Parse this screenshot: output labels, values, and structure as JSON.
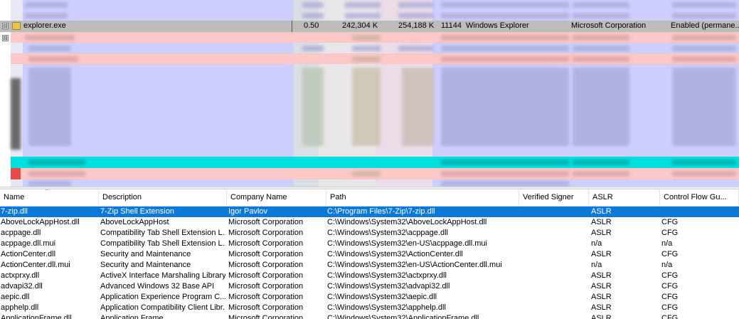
{
  "process_pane": {
    "explorer_row": {
      "name": "explorer.exe",
      "cpu": "0.50",
      "private_bytes": "242,304 K",
      "working_set": "254,188 K",
      "pid": "11144",
      "description": "Windows Explorer",
      "company": "Microsoft Corporation",
      "dep": "Enabled (permane...",
      "expander": "⊟"
    },
    "second_expander": "⊟",
    "colors": {
      "highlight_service": "#cfcfff",
      "new_process": "#ffc8c8",
      "cyan": "#00e0e0",
      "selected_gray": "#bcbcbc"
    }
  },
  "dll_pane": {
    "columns": [
      "Name",
      "Description",
      "Company Name",
      "Path",
      "Verified Signer",
      "ASLR",
      "Control Flow Gu..."
    ],
    "sort_indicator": "^",
    "rows": [
      {
        "name": "7-zip.dll",
        "desc": "7-Zip Shell Extension",
        "company": "Igor Pavlov",
        "path": "C:\\Program Files\\7-Zip\\7-zip.dll",
        "signer": "",
        "aslr": "ASLR",
        "cfg": ""
      },
      {
        "name": "AboveLockAppHost.dll",
        "desc": "AboveLockAppHost",
        "company": "Microsoft Corporation",
        "path": "C:\\Windows\\System32\\AboveLockAppHost.dll",
        "signer": "",
        "aslr": "ASLR",
        "cfg": "CFG"
      },
      {
        "name": "acppage.dll",
        "desc": "Compatibility Tab Shell Extension L...",
        "company": "Microsoft Corporation",
        "path": "C:\\Windows\\System32\\acppage.dll",
        "signer": "",
        "aslr": "ASLR",
        "cfg": "CFG"
      },
      {
        "name": "acppage.dll.mui",
        "desc": "Compatibility Tab Shell Extension L...",
        "company": "Microsoft Corporation",
        "path": "C:\\Windows\\System32\\en-US\\acppage.dll.mui",
        "signer": "",
        "aslr": "n/a",
        "cfg": "n/a"
      },
      {
        "name": "ActionCenter.dll",
        "desc": "Security and Maintenance",
        "company": "Microsoft Corporation",
        "path": "C:\\Windows\\System32\\ActionCenter.dll",
        "signer": "",
        "aslr": "ASLR",
        "cfg": "CFG"
      },
      {
        "name": "ActionCenter.dll.mui",
        "desc": "Security and Maintenance",
        "company": "Microsoft Corporation",
        "path": "C:\\Windows\\System32\\en-US\\ActionCenter.dll.mui",
        "signer": "",
        "aslr": "n/a",
        "cfg": "n/a"
      },
      {
        "name": "actxprxy.dll",
        "desc": "ActiveX Interface Marshaling Library",
        "company": "Microsoft Corporation",
        "path": "C:\\Windows\\System32\\actxprxy.dll",
        "signer": "",
        "aslr": "ASLR",
        "cfg": "CFG"
      },
      {
        "name": "advapi32.dll",
        "desc": "Advanced Windows 32 Base API",
        "company": "Microsoft Corporation",
        "path": "C:\\Windows\\System32\\advapi32.dll",
        "signer": "",
        "aslr": "ASLR",
        "cfg": "CFG"
      },
      {
        "name": "aepic.dll",
        "desc": "Application Experience Program C...",
        "company": "Microsoft Corporation",
        "path": "C:\\Windows\\System32\\aepic.dll",
        "signer": "",
        "aslr": "ASLR",
        "cfg": "CFG"
      },
      {
        "name": "apphelp.dll",
        "desc": "Application Compatibility Client Libr...",
        "company": "Microsoft Corporation",
        "path": "C:\\Windows\\System32\\apphelp.dll",
        "signer": "",
        "aslr": "ASLR",
        "cfg": "CFG"
      },
      {
        "name": "ApplicationFrame.dll",
        "desc": "Application Frame",
        "company": "Microsoft Corporation",
        "path": "C:\\Windows\\System32\\ApplicationFrame.dll",
        "signer": "",
        "aslr": "ASLR",
        "cfg": "CFG"
      }
    ],
    "selected_row": 0,
    "colors": {
      "selection": "#0a78d7"
    }
  }
}
